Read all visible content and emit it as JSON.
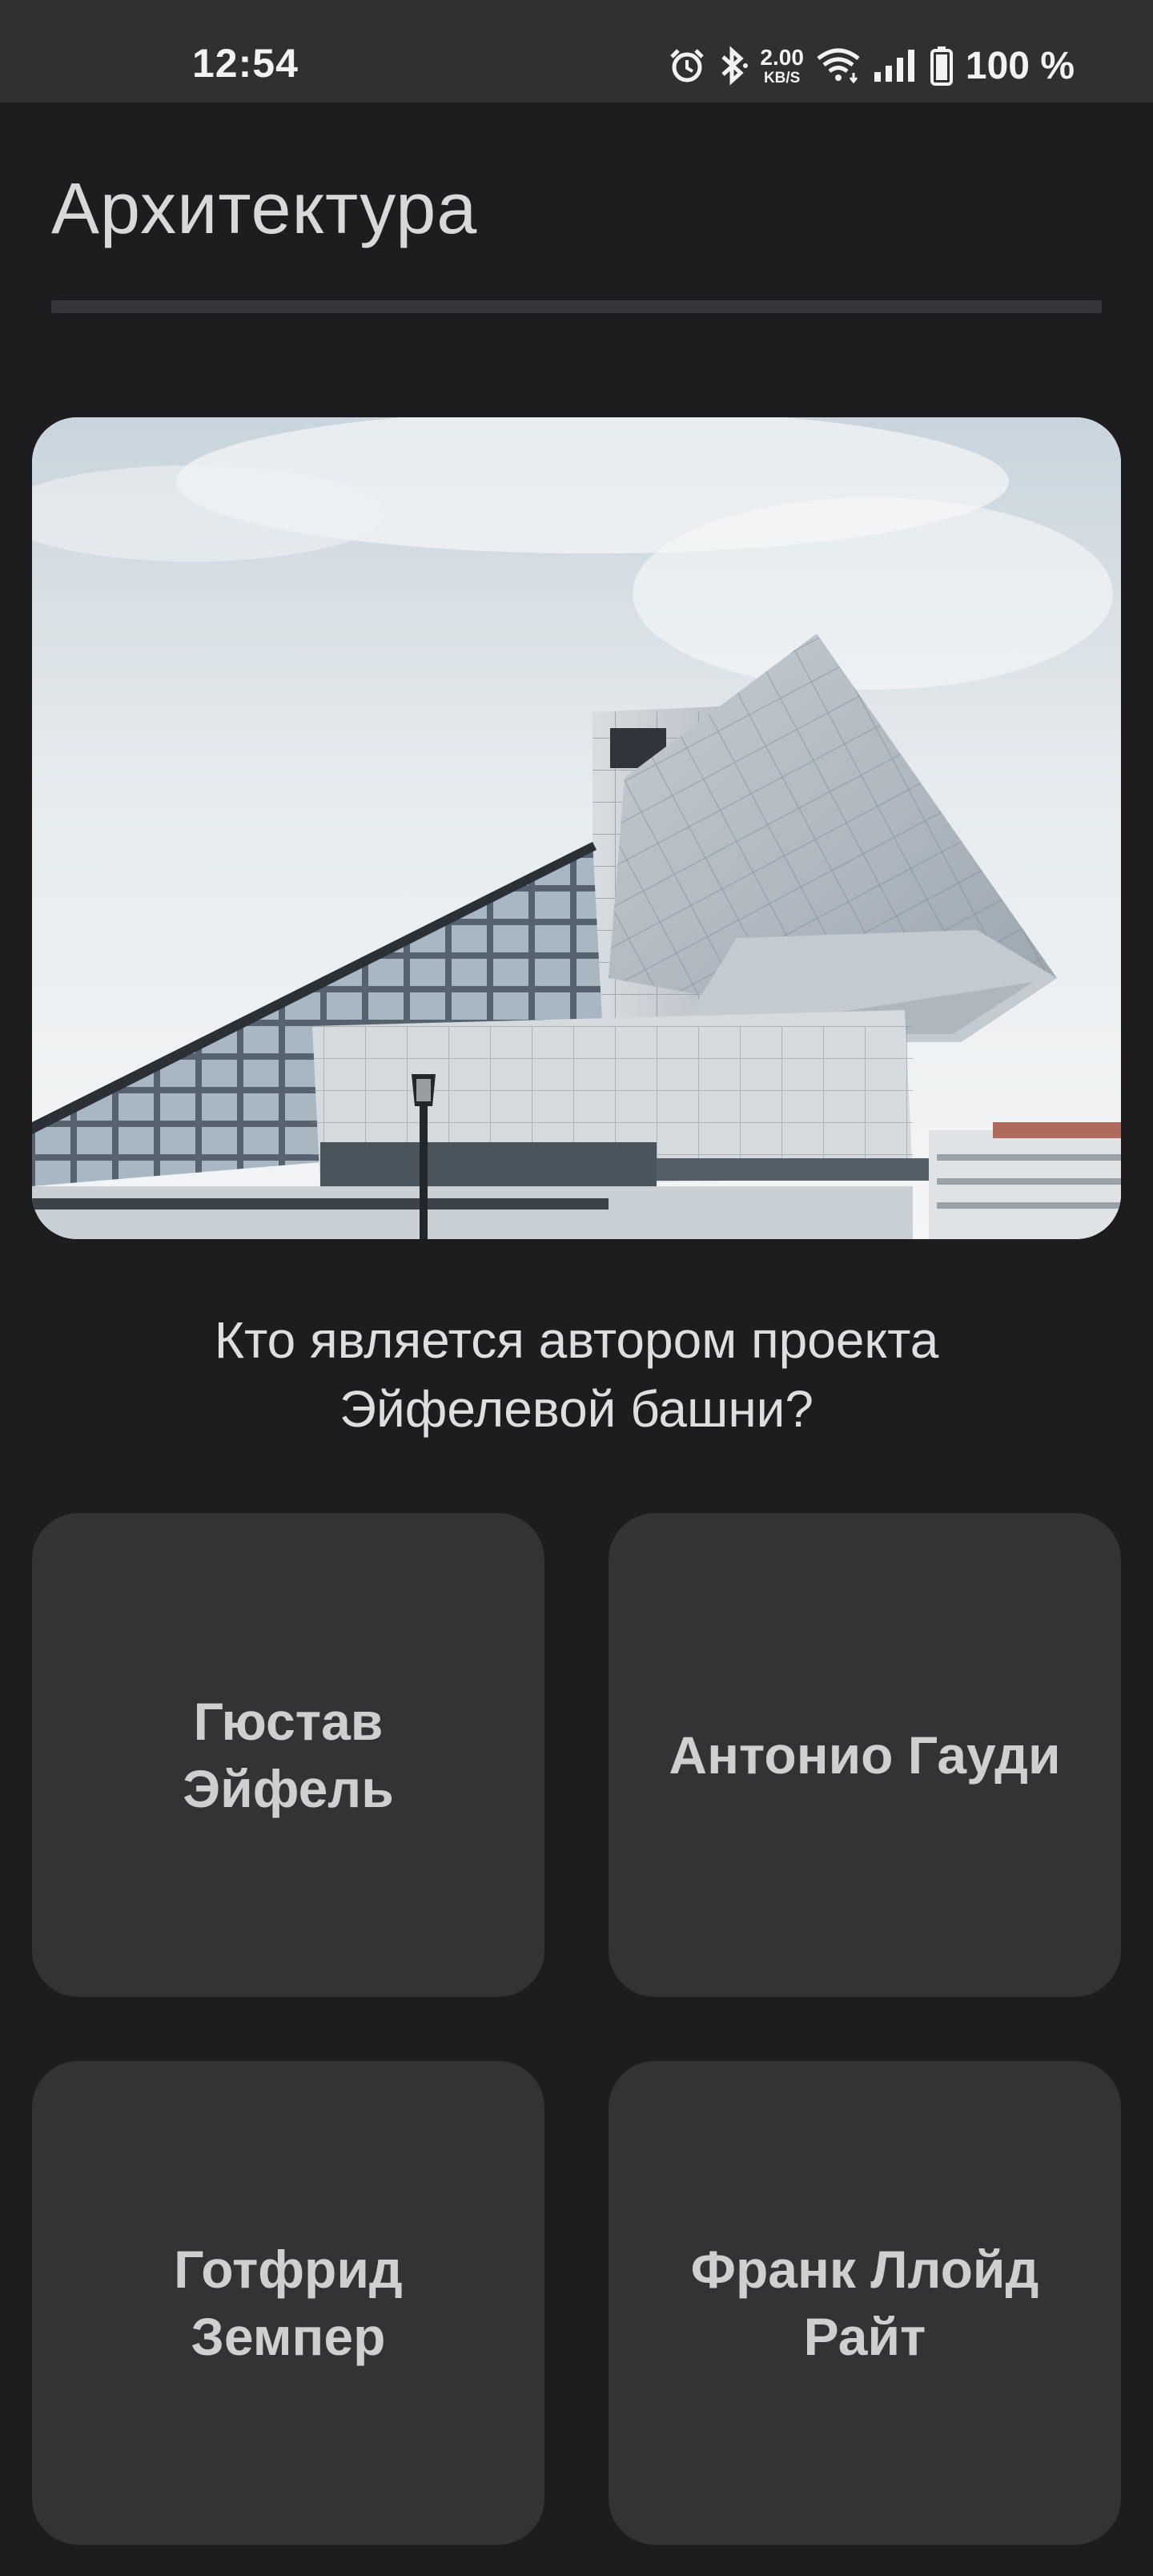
{
  "status_bar": {
    "time": "12:54",
    "net_speed_value": "2.00",
    "net_speed_unit": "KB/S",
    "battery": "100 %",
    "icons": [
      "alarm-icon",
      "bluetooth-icon",
      "wifi-icon",
      "signal-icon",
      "battery-icon"
    ]
  },
  "header": {
    "title": "Архитектура"
  },
  "hero_image": {
    "subject": "modern-building-photo"
  },
  "question": {
    "line1": "Кто является автором проекта",
    "line2": "Эйфелевой башни?"
  },
  "answers": [
    {
      "line1": "Гюстав",
      "line2": "Эйфель"
    },
    {
      "line1": "Антонио Гауди",
      "line2": ""
    },
    {
      "line1": "Готфрид",
      "line2": "Земпер"
    },
    {
      "line1": "Франк Ллойд",
      "line2": "Райт"
    }
  ],
  "colors": {
    "background": "#1d1d20",
    "status_bar": "#303030",
    "card": "#333335",
    "text": "#dedede"
  }
}
